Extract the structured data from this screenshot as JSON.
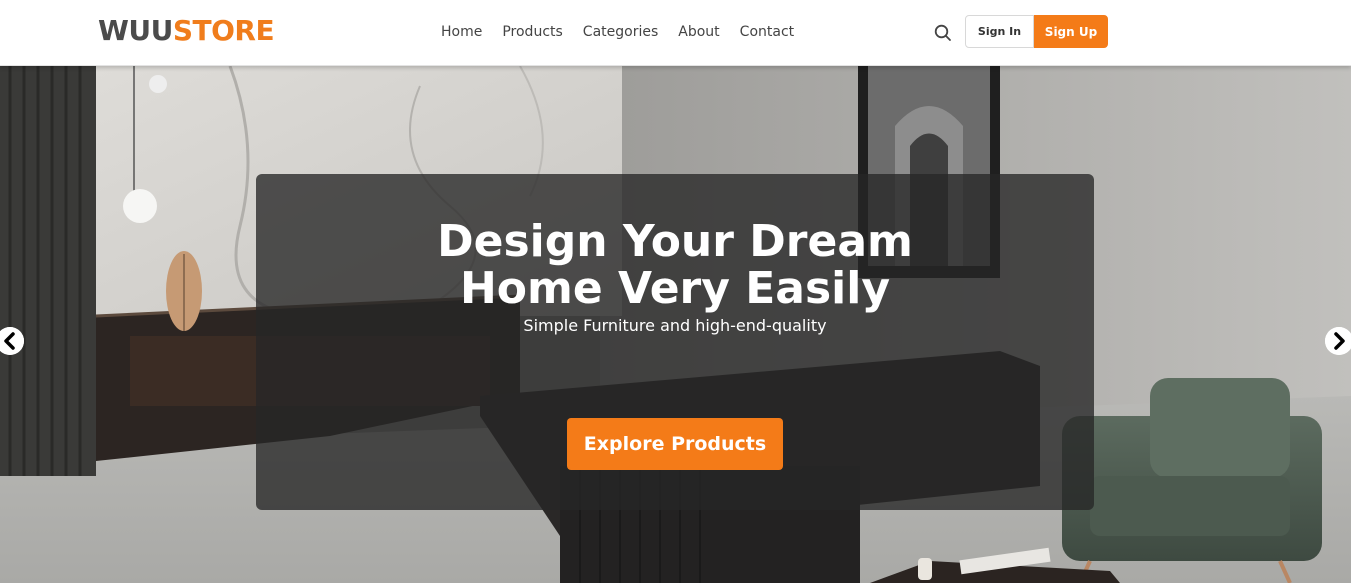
{
  "header": {
    "logo_part1": "WUU",
    "logo_part2": "STORE",
    "nav": [
      "Home",
      "Products",
      "Categories",
      "About",
      "Contact"
    ],
    "search_icon": "search-icon",
    "signin_label": "Sign In",
    "signup_label": "Sign Up"
  },
  "hero": {
    "title_line1": "Design Your Dream",
    "title_line2": "Home Very Easily",
    "subtitle": "Simple Furniture and high-end-quality",
    "cta_label": "Explore Products",
    "prev_icon": "chevron-left-icon",
    "next_icon": "chevron-right-icon"
  },
  "colors": {
    "accent": "#f47b18",
    "logo_dark": "#4b4b4b",
    "overlay": "#262626"
  }
}
